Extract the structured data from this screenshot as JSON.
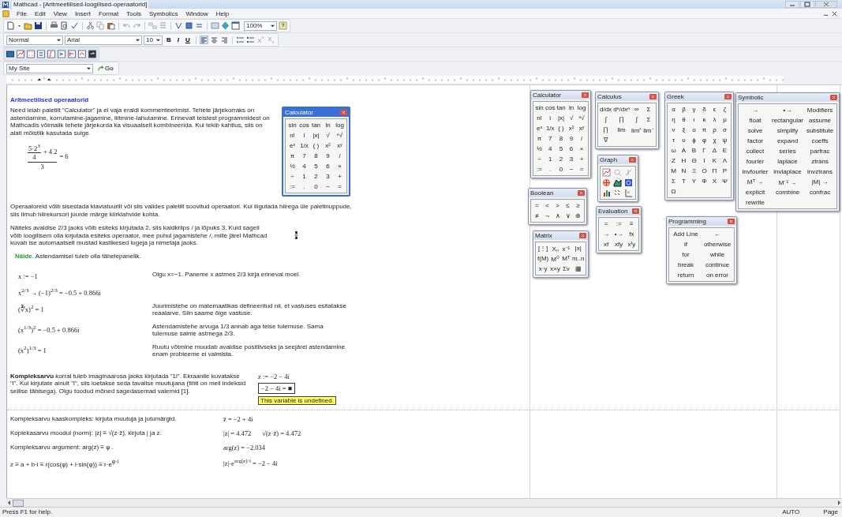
{
  "window": {
    "title": "Mathcad - [Aritmeetilised-loogilised-operaatorid]"
  },
  "menu": [
    "File",
    "Edit",
    "View",
    "Insert",
    "Format",
    "Tools",
    "Symbolics",
    "Window",
    "Help"
  ],
  "toolbar": {
    "zoom": "100%"
  },
  "format_bar": {
    "style": "Normal",
    "font": "Arial",
    "size": "10",
    "bold": "B",
    "italic": "I",
    "underline": "U",
    "alignment": [
      {
        "selected": true
      },
      {
        "selected": false
      },
      {
        "selected": false
      }
    ]
  },
  "web_bar": {
    "address": "My Site",
    "go": "Go"
  },
  "worksheet": {
    "heading": "Aritmeetilised operaatorid",
    "intro": "Need leiab paletilt \"Calculator\" ja ei vaja eraldi kommenteerimist. Tehete järjekorraks on astendamine, korrutamine-jagamine, liitmine-lahutamine. Erinevalt teistest programmidest on Mathcadis võimalik tehete järjekorda ka visuaalselt kombineerida. Kui tekib kahtlus, siis on alati mõistlik kasutada sulge.",
    "expression": {
      "inner_numerator": "5·2$^{3}$",
      "inner_denominator": "4",
      "numerator_rest": "+ 4.2",
      "denominator": "3",
      "result": "= 6"
    },
    "calculator": {
      "title": "Calculator",
      "kind": "text",
      "rows": [
        [
          "sin",
          "cos",
          "tan",
          "ln",
          "log"
        ],
        [
          "n!",
          "i",
          "|x|",
          "√",
          "ⁿ√"
        ],
        [
          "eˣ",
          "1/x",
          "( )",
          "x²",
          "xʸ"
        ],
        [
          "π",
          "7",
          "8",
          "9",
          "/"
        ],
        [
          "½",
          "4",
          "5",
          "6",
          "×"
        ],
        [
          "÷",
          "1",
          "2",
          "3",
          "+"
        ],
        [
          ":=",
          ".",
          "0",
          "−",
          "="
        ]
      ]
    },
    "paragraph_2": "Operaatoreid võib sisestada klaviatuurilt või siis valides paletilt soovitud operaatori. Kui liigutada hiirega üle paletinuppude, siis ilmub hiirekursori juurde märge kiirklahvide kohta.",
    "paragraph_3": "Näiteks avaldise 2/3 jaoks võib esiteks kirjutada 2, siis kaldkriips / ja lõpuks 3. Kuid sageli võib loogilisem olla kirjutada esiteks operaator, mee puhul jagamistehe /, mille järel Mathcad kuvab ise automaatselt mustad kastikesed lugeja ja nimetaja jaoks.",
    "note": {
      "label": "Näide.",
      "text": "Astendamisel tuleb olla tähelepanelik."
    },
    "examples": [
      {
        "math": "x := −1",
        "comment": "Olgu x=−1. Paneme x astmes 2/3 kirja erineval moel."
      },
      {
        "math": "x$^{2/3}$ → (−1)$^{2/3}$ = −0.5 + 0.866i"
      },
      {
        "math": "(∛x)$^{2}$ = 1",
        "comment": "Juurimistehe on matemaatikas defineeritud nii, et vastuses esitatakse reaalarve. Siin saame õige vastuse."
      },
      {
        "math": "(x$^{1/3}$)$^{2}$ = −0.5 + 0.866i",
        "comment": "Astendamistehe arvuga 1/3 annab aga teise tulemuse. Sama tulemuse saime astmega 2/3."
      },
      {
        "math": "(x$^{2}$)$^{1/3}$ = 1",
        "comment": "Ruutu võtmine muudab avaldise positiivseks ja seejärel astendamine enam probleeme ei valmista."
      }
    ],
    "complex": {
      "text": "**Kompleksarvu** korral tuleb imaginaarosa jaoks kirjutada \"1i\". Ekraanile kuvatakse \"i\". Kui kirjutate ainult \"i\", siis loetakse seda tavalise muutujana (tihti on meil indeksid sellise tähisega). Olgu toodud mõned sagedasemad valemid [1].",
      "definition": "z := −2 − 4i",
      "error_expression": "−2 − 4i = ■",
      "tooltip": "This variable is undefined."
    },
    "formulas": [
      {
        "text": "Kompleksarvu kaaskompleks: kirjuta muutuja ja jutumärgid.",
        "results": [
          "z̄ = −2 + 4i"
        ]
      },
      {
        "text": "Koplekasarvu moodul (norm):  |z| ≡ √(z·z̄), kirjuta | ja z.",
        "results": [
          "|z| = 4.472",
          "√(z·z̄) = 4.472"
        ]
      },
      {
        "text": "Kompleksarvu argument:  arg(z) ≡ φ .",
        "results": [
          "arg(z) = −2.034"
        ]
      },
      {
        "text": "z ≡ a + b·i ≡ r(cos(φ) + i·sin(φ)) ≡ r·e$^{φ·i}$",
        "results": [
          "|z|·e$^{arg(z)·i}$ = −2 − 4i"
        ]
      }
    ]
  },
  "palettes": [
    {
      "title": "Calculator",
      "kind": "text",
      "rows": [
        [
          "sin",
          "cos",
          "tan",
          "ln",
          "log"
        ],
        [
          "n!",
          "i",
          "|x|",
          "√",
          "ⁿ√"
        ],
        [
          "eˣ",
          "1/x",
          "( )",
          "x²",
          "xʸ"
        ],
        [
          "π",
          "7",
          "8",
          "9",
          "/"
        ],
        [
          "½",
          "4",
          "5",
          "6",
          "×"
        ],
        [
          "÷",
          "1",
          "2",
          "3",
          "+"
        ],
        [
          ":=",
          ".",
          "0",
          "−",
          "="
        ]
      ]
    },
    {
      "title": "Calculus",
      "kind": "text",
      "rows": [
        [
          "d/dx",
          "dⁿ/dxⁿ",
          "∞",
          "Σ"
        ],
        [
          "∫",
          "∏",
          "∫",
          "Σ"
        ],
        [
          "∏",
          "lim",
          "lim⁺",
          "lim⁻"
        ],
        [
          "∇"
        ]
      ]
    },
    {
      "title": "Graph",
      "kind": "icons"
    },
    {
      "title": "Boolean",
      "kind": "text",
      "rows": [
        [
          "=",
          "<",
          ">",
          "≤",
          "≥"
        ],
        [
          "≠",
          "¬",
          "∧",
          "∨",
          "⊕"
        ]
      ]
    },
    {
      "title": "Matrix",
      "kind": "text",
      "rows": [
        [
          "[⋮]",
          "Xₙ",
          "x⁻¹",
          "|x|"
        ],
        [
          "f(M)",
          "M⁽⁾",
          "Mᵀ",
          "m..n"
        ],
        [
          "x·y",
          "x×y",
          "Σv",
          "▦"
        ]
      ]
    },
    {
      "title": "Evaluation",
      "kind": "text",
      "rows": [
        [
          "=",
          ":=",
          "≡"
        ],
        [
          "→",
          "•→",
          "fx"
        ],
        [
          "xf",
          "xfy",
          "xᶠy"
        ]
      ]
    },
    {
      "title": "Greek",
      "kind": "text",
      "rows": [
        [
          "α",
          "β",
          "γ",
          "δ",
          "ε",
          "ζ"
        ],
        [
          "η",
          "θ",
          "ι",
          "κ",
          "λ",
          "μ"
        ],
        [
          "ν",
          "ξ",
          "ο",
          "π",
          "ρ",
          "σ"
        ],
        [
          "τ",
          "υ",
          "ϕ",
          "φ",
          "χ",
          "ψ"
        ],
        [
          "ω",
          "Α",
          "Β",
          "Γ",
          "Δ",
          "Ε"
        ],
        [
          "Ζ",
          "Η",
          "Θ",
          "Ι",
          "Κ",
          "Λ"
        ],
        [
          "Μ",
          "Ν",
          "Ξ",
          "Ο",
          "Π",
          "Ρ"
        ],
        [
          "Σ",
          "Τ",
          "Υ",
          "Φ",
          "Χ",
          "Ψ"
        ],
        [
          "Ω"
        ]
      ]
    },
    {
      "title": "Programming",
      "kind": "text",
      "rows": [
        [
          "Add Line",
          "←"
        ],
        [
          "if",
          "otherwise"
        ],
        [
          "for",
          "while"
        ],
        [
          "break",
          "continue"
        ],
        [
          "return",
          "on error"
        ]
      ]
    },
    {
      "title": "Symbolic",
      "kind": "text",
      "rows": [
        [
          "→",
          "•→",
          "Modifiers"
        ],
        [
          "float",
          "rectangular",
          "assume"
        ],
        [
          "solve",
          "simplify",
          "substitute"
        ],
        [
          "factor",
          "expand",
          "coeffs"
        ],
        [
          "collect",
          "series",
          "parfrac"
        ],
        [
          "fourier",
          "laplace",
          "ztrans"
        ],
        [
          "invfourier",
          "invlaplace",
          "invztrans"
        ],
        [
          "Mᵀ →",
          "M⁻¹ →",
          "|M| →"
        ],
        [
          "explicit",
          "combine",
          "confrac"
        ],
        [
          "rewrite"
        ]
      ]
    }
  ],
  "status_bar": {
    "help": "Press F1 for help.",
    "mode": "AUTO",
    "page": "Page"
  }
}
